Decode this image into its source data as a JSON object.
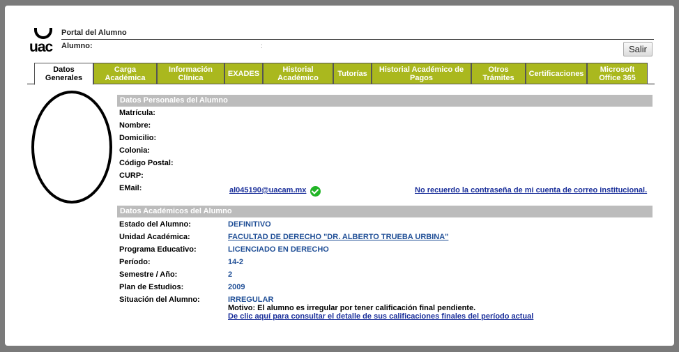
{
  "header": {
    "logo_text": "uac",
    "portal_title": "Portal del Alumno",
    "alumno_label": "Alumno:",
    "alumno_separator": ":",
    "salir_label": "Salir"
  },
  "tabs": [
    {
      "label": "Datos Generales",
      "active": true
    },
    {
      "label": "Carga Académica",
      "active": false
    },
    {
      "label": "Información Clínica",
      "active": false
    },
    {
      "label": "EXADES",
      "active": false
    },
    {
      "label": "Historial Académico",
      "active": false
    },
    {
      "label": "Tutorías",
      "active": false
    },
    {
      "label": "Historial Académico de Pagos",
      "active": false
    },
    {
      "label": "Otros Trámites",
      "active": false
    },
    {
      "label": "Certificaciones",
      "active": false
    },
    {
      "label": "Microsoft Office 365",
      "active": false
    }
  ],
  "personal": {
    "section_title": "Datos Personales del Alumno",
    "matricula_label": "Matrícula:",
    "nombre_label": "Nombre:",
    "domicilio_label": "Domicilio:",
    "colonia_label": "Colonia:",
    "codigo_postal_label": "Código Postal:",
    "curp_label": "CURP:",
    "email_label": "EMail:",
    "email_value": "al045190@uacam.mx",
    "forgot_password_link": "No recuerdo la contraseña de mi cuenta de correo institucional."
  },
  "academic": {
    "section_title": "Datos Académicos del Alumno",
    "estado_label": "Estado del Alumno:",
    "estado_value": "DEFINITIVO",
    "unidad_label": "Unidad Académica:",
    "unidad_value": "FACULTAD DE DERECHO \"DR. ALBERTO TRUEBA URBINA\"",
    "programa_label": "Programa Educativo:",
    "programa_value": "LICENCIADO EN DERECHO",
    "periodo_label": "Período:",
    "periodo_value": "14-2",
    "semestre_label": "Semestre / Año:",
    "semestre_value": "2",
    "plan_label": "Plan de Estudios:",
    "plan_value": "2009",
    "situacion_label": "Situación del Alumno:",
    "situacion_value": "IRREGULAR",
    "motivo_text": "Motivo: El alumno es irregular por tener calificación final pendiente.",
    "detalle_link": "De clic aquí para consultar el detalle de sus calificaciones finales del período actual"
  },
  "colors": {
    "tab_green": "#aab81e",
    "section_gray": "#bcbcbc",
    "value_blue": "#1f4e96",
    "link_blue": "#1a2f9a",
    "check_green": "#21b526"
  },
  "icons": {
    "photo_placeholder": "oval-photo-placeholder",
    "email_verified": "check-circle-icon"
  }
}
